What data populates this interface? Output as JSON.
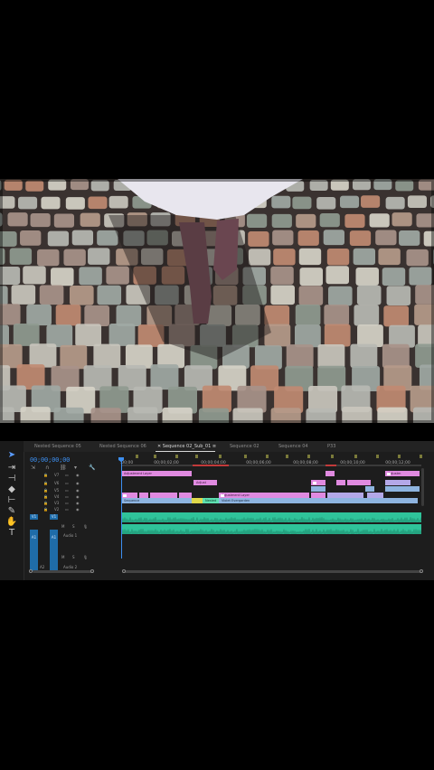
{
  "video": {
    "description_icon": "video-frame"
  },
  "timeline": {
    "tabs": [
      "Nested Sequence 05",
      "Nested Sequence 06",
      "Sequence 02_Sub_01",
      "Sequence 02",
      "Sequence 04",
      "P33"
    ],
    "active_tab_close": "≡",
    "timecode": "00;00;00;00",
    "ruler_labels": [
      ":00;00",
      "00;00;02;00",
      "00;00;04;00",
      "00;00;06;00",
      "00;00;08;00",
      "00;00;10;00",
      "00;00;12;00"
    ],
    "video_tracks": [
      "V7",
      "V6",
      "V5",
      "V4",
      "V3",
      "V2"
    ],
    "source_patch_v": "V1",
    "audio_track_a1": {
      "patch": "A1",
      "target": "A1",
      "name": "Audio 1",
      "m": "M",
      "s": "S"
    },
    "audio_track_a2": {
      "patch": "A2",
      "name": "Audio 2",
      "m": "M",
      "s": "S"
    },
    "clips": {
      "adj1": "Adjustment Layer",
      "adj2": "Adjust",
      "adj3": "Adjustment Layer",
      "nested": "Nested",
      "adj4": "Adjustm",
      "adj5": "Adjustm",
      "s1": "Sequence",
      "v2a": "Violet Evergarden",
      "v2b": "Nested"
    }
  },
  "colors": {
    "playhead": "#3d8ff0",
    "clip_pink": "#e08ae0",
    "clip_blue": "#8eb4e0",
    "audio": "#2fc39a"
  }
}
